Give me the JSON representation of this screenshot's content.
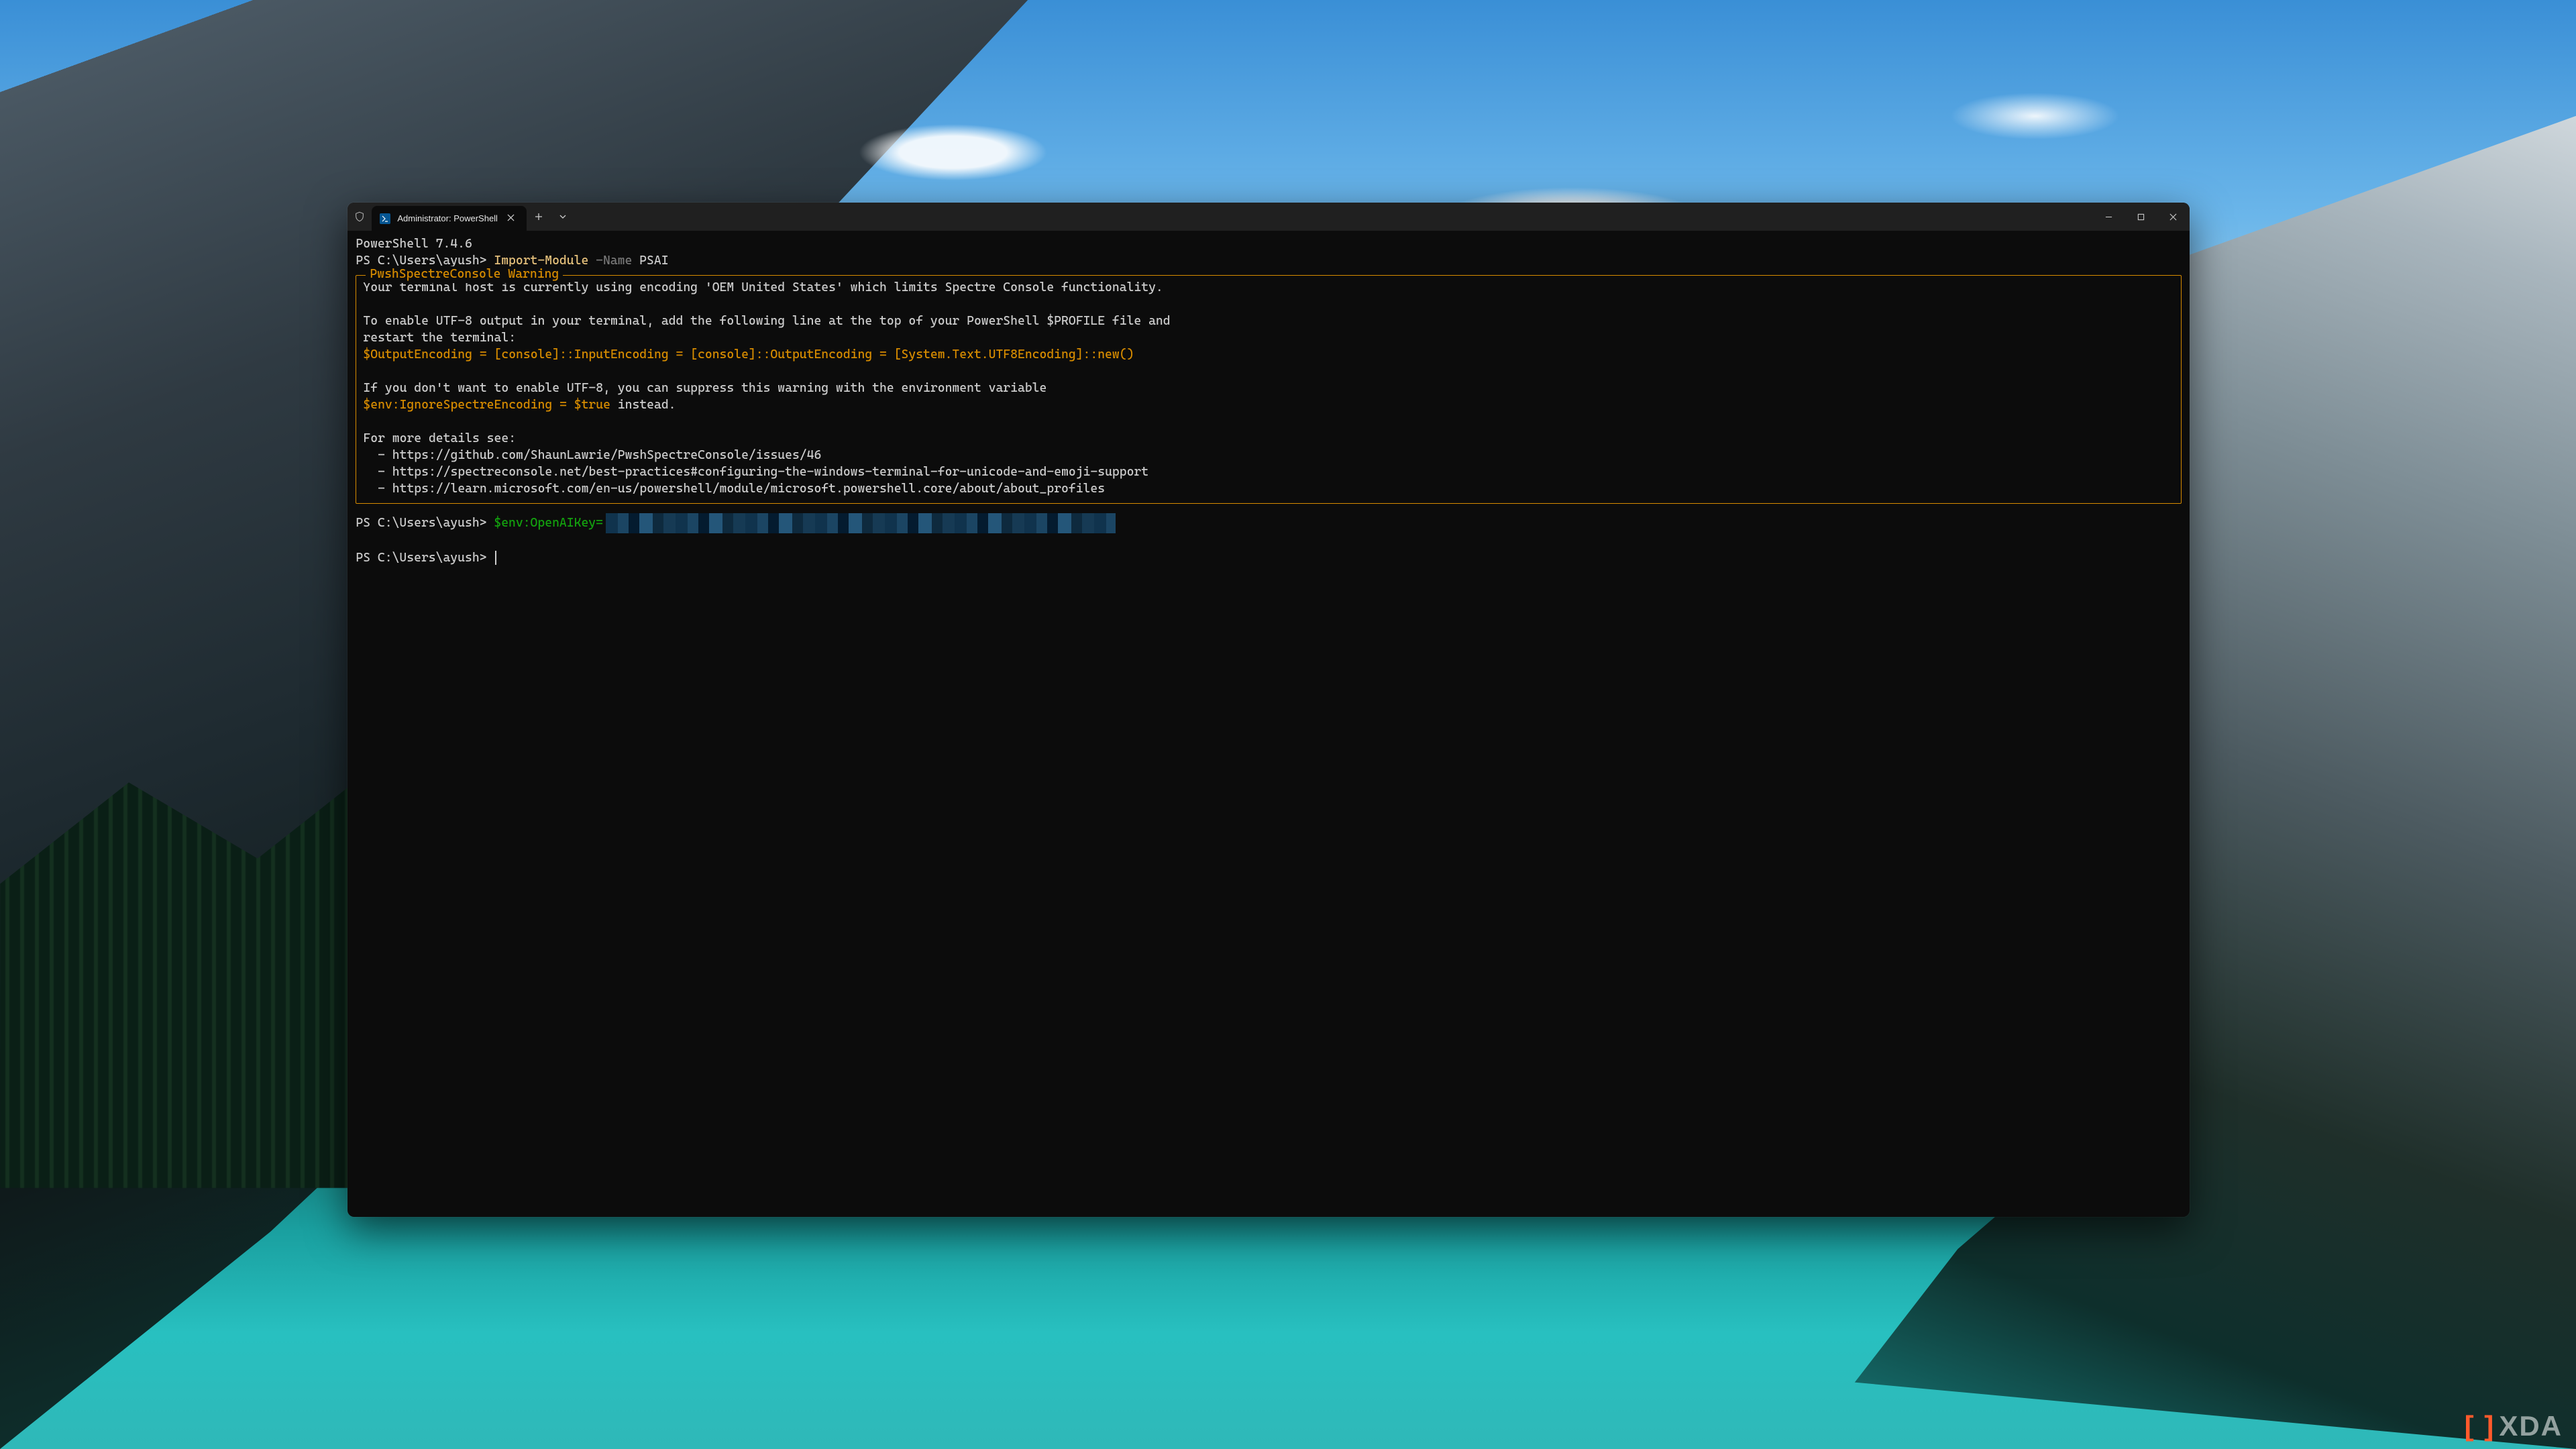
{
  "watermark": {
    "text": "XDA"
  },
  "window": {
    "tab_title": "Administrator: PowerShell"
  },
  "terminal": {
    "banner": "PowerShell 7.4.6",
    "prompt_path": "PS C:\\Users\\ayush>",
    "line1": {
      "cmd": "Import-Module",
      "flag": "-Name",
      "arg": "PSAI"
    },
    "warn": {
      "title": "PwshSpectreConsole Warning",
      "l1": "Your terminal host is currently using encoding 'OEM United States' which limits Spectre Console functionality.",
      "l2a": "To enable UTF-8 output in your terminal, add the following line at the top of your PowerShell $PROFILE file and",
      "l2b": "restart the terminal:",
      "code1": "$OutputEncoding = [console]::InputEncoding = [console]::OutputEncoding = [System.Text.UTF8Encoding]::new()",
      "l3a": "If you don't want to enable UTF-8, you can suppress this warning with the environment variable",
      "code2": "$env:IgnoreSpectreEncoding = $true",
      "l3b": " instead.",
      "l4": "For more details see:",
      "link1": "https://github.com/ShaunLawrie/PwshSpectreConsole/issues/46",
      "link2": "https://spectreconsole.net/best-practices#configuring-the-windows-terminal-for-unicode-and-emoji-support",
      "link3": "https://learn.microsoft.com/en-us/powershell/module/microsoft.powershell.core/about/about_profiles"
    },
    "line2_cmd": "$env:OpenAIKey=",
    "bullet": "  - "
  }
}
